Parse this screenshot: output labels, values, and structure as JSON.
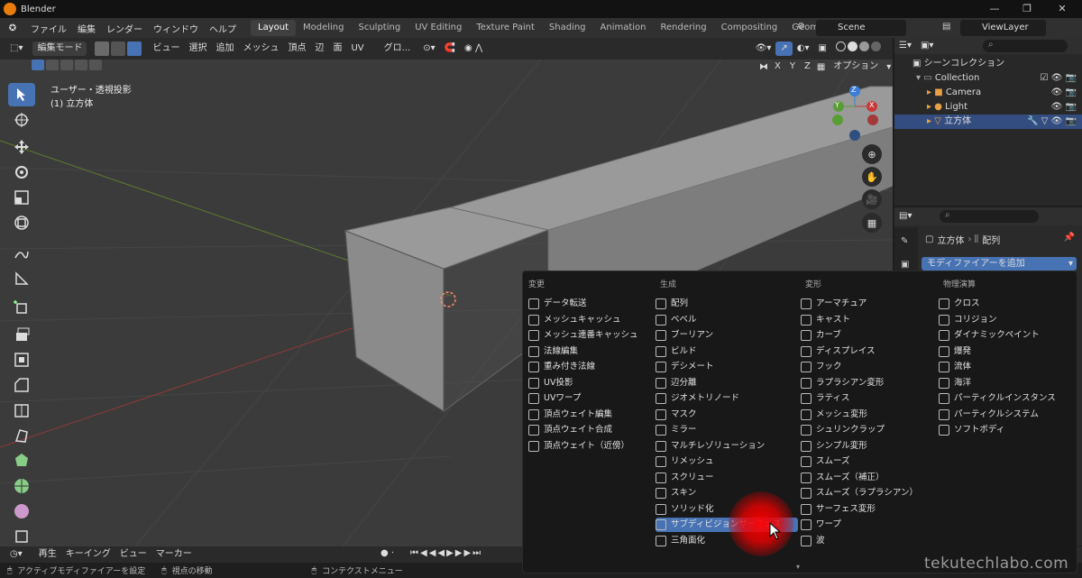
{
  "window": {
    "title": "Blender",
    "controls": [
      "—",
      "❐",
      "✕"
    ]
  },
  "menus": [
    "ファイル",
    "編集",
    "レンダー",
    "ウィンドウ",
    "ヘルプ"
  ],
  "workspaces": [
    "Layout",
    "Modeling",
    "Sculpting",
    "UV Editing",
    "Texture Paint",
    "Shading",
    "Animation",
    "Rendering",
    "Compositing",
    "Geometry Node"
  ],
  "active_workspace": "Layout",
  "scene": "Scene",
  "view_layer": "ViewLayer",
  "viewport_header": {
    "mode": "編集モード",
    "items": [
      "ビュー",
      "選択",
      "追加",
      "メッシュ",
      "頂点",
      "辺",
      "面",
      "UV"
    ],
    "transform": "グロ...",
    "axes": [
      "X",
      "Y",
      "Z"
    ],
    "options": "オプション"
  },
  "viewport": {
    "view_name": "ユーザー・透視投影",
    "object_name": "(1) 立方体",
    "gizmo": [
      "Z",
      "Y",
      "X"
    ]
  },
  "outliner": {
    "root": "シーンコレクション",
    "collection": "Collection",
    "items": [
      "Camera",
      "Light",
      "立方体"
    ]
  },
  "properties": {
    "object": "立方体",
    "modifier": "配列",
    "add_modifier": "モディファイアーを追加"
  },
  "timeline": {
    "items": [
      "再生",
      "キーイング",
      "ビュー",
      "マーカー"
    ]
  },
  "status": {
    "hints": [
      "アクティブモディファイアーを設定",
      "視点の移動",
      "コンテクストメニュー"
    ]
  },
  "modifier_menu": {
    "columns": [
      "変更",
      "生成",
      "変形",
      "物理演算"
    ],
    "edit": [
      "データ転送",
      "メッシュキャッシュ",
      "メッシュ連番キャッシュ",
      "法線編集",
      "重み付き法線",
      "UV投影",
      "UVワープ",
      "頂点ウェイト編集",
      "頂点ウェイト合成",
      "頂点ウェイト（近傍）"
    ],
    "generate": [
      "配列",
      "ベベル",
      "ブーリアン",
      "ビルド",
      "デシメート",
      "辺分離",
      "ジオメトリノード",
      "マスク",
      "ミラー",
      "マルチレゾリューション",
      "リメッシュ",
      "スクリュー",
      "スキン",
      "ソリッド化",
      "サブディビジョンサーフェス",
      "三角面化"
    ],
    "deform": [
      "アーマチュア",
      "キャスト",
      "カーブ",
      "ディスプレイス",
      "フック",
      "ラプラシアン変形",
      "ラティス",
      "メッシュ変形",
      "シュリンクラップ",
      "シンプル変形",
      "スムーズ",
      "スムーズ（補正）",
      "スムーズ（ラプラシアン）",
      "サーフェス変形",
      "ワープ",
      "波"
    ],
    "physics": [
      "クロス",
      "コリジョン",
      "ダイナミックペイント",
      "爆発",
      "流体",
      "海洋",
      "パーティクルインスタンス",
      "パーティクルシステム",
      "ソフトボディ"
    ],
    "highlighted": "サブディビジョンサーフェス"
  },
  "watermark": "tekutechlabo.com",
  "colors": {
    "accent": "#4772b3",
    "selection": "#334d80",
    "highlight_glow": "#ff0000"
  }
}
